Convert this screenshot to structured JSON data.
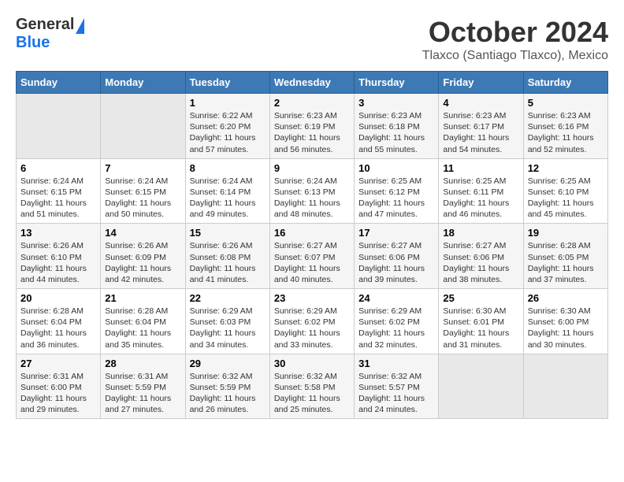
{
  "header": {
    "logo_general": "General",
    "logo_blue": "Blue",
    "month_title": "October 2024",
    "location": "Tlaxco (Santiago Tlaxco), Mexico"
  },
  "days_of_week": [
    "Sunday",
    "Monday",
    "Tuesday",
    "Wednesday",
    "Thursday",
    "Friday",
    "Saturday"
  ],
  "weeks": [
    [
      {
        "day": "",
        "info": ""
      },
      {
        "day": "",
        "info": ""
      },
      {
        "day": "1",
        "sunrise": "6:22 AM",
        "sunset": "6:20 PM",
        "daylight": "11 hours and 57 minutes."
      },
      {
        "day": "2",
        "sunrise": "6:23 AM",
        "sunset": "6:19 PM",
        "daylight": "11 hours and 56 minutes."
      },
      {
        "day": "3",
        "sunrise": "6:23 AM",
        "sunset": "6:18 PM",
        "daylight": "11 hours and 55 minutes."
      },
      {
        "day": "4",
        "sunrise": "6:23 AM",
        "sunset": "6:17 PM",
        "daylight": "11 hours and 54 minutes."
      },
      {
        "day": "5",
        "sunrise": "6:23 AM",
        "sunset": "6:16 PM",
        "daylight": "11 hours and 52 minutes."
      }
    ],
    [
      {
        "day": "6",
        "sunrise": "6:24 AM",
        "sunset": "6:15 PM",
        "daylight": "11 hours and 51 minutes."
      },
      {
        "day": "7",
        "sunrise": "6:24 AM",
        "sunset": "6:15 PM",
        "daylight": "11 hours and 50 minutes."
      },
      {
        "day": "8",
        "sunrise": "6:24 AM",
        "sunset": "6:14 PM",
        "daylight": "11 hours and 49 minutes."
      },
      {
        "day": "9",
        "sunrise": "6:24 AM",
        "sunset": "6:13 PM",
        "daylight": "11 hours and 48 minutes."
      },
      {
        "day": "10",
        "sunrise": "6:25 AM",
        "sunset": "6:12 PM",
        "daylight": "11 hours and 47 minutes."
      },
      {
        "day": "11",
        "sunrise": "6:25 AM",
        "sunset": "6:11 PM",
        "daylight": "11 hours and 46 minutes."
      },
      {
        "day": "12",
        "sunrise": "6:25 AM",
        "sunset": "6:10 PM",
        "daylight": "11 hours and 45 minutes."
      }
    ],
    [
      {
        "day": "13",
        "sunrise": "6:26 AM",
        "sunset": "6:10 PM",
        "daylight": "11 hours and 44 minutes."
      },
      {
        "day": "14",
        "sunrise": "6:26 AM",
        "sunset": "6:09 PM",
        "daylight": "11 hours and 42 minutes."
      },
      {
        "day": "15",
        "sunrise": "6:26 AM",
        "sunset": "6:08 PM",
        "daylight": "11 hours and 41 minutes."
      },
      {
        "day": "16",
        "sunrise": "6:27 AM",
        "sunset": "6:07 PM",
        "daylight": "11 hours and 40 minutes."
      },
      {
        "day": "17",
        "sunrise": "6:27 AM",
        "sunset": "6:06 PM",
        "daylight": "11 hours and 39 minutes."
      },
      {
        "day": "18",
        "sunrise": "6:27 AM",
        "sunset": "6:06 PM",
        "daylight": "11 hours and 38 minutes."
      },
      {
        "day": "19",
        "sunrise": "6:28 AM",
        "sunset": "6:05 PM",
        "daylight": "11 hours and 37 minutes."
      }
    ],
    [
      {
        "day": "20",
        "sunrise": "6:28 AM",
        "sunset": "6:04 PM",
        "daylight": "11 hours and 36 minutes."
      },
      {
        "day": "21",
        "sunrise": "6:28 AM",
        "sunset": "6:04 PM",
        "daylight": "11 hours and 35 minutes."
      },
      {
        "day": "22",
        "sunrise": "6:29 AM",
        "sunset": "6:03 PM",
        "daylight": "11 hours and 34 minutes."
      },
      {
        "day": "23",
        "sunrise": "6:29 AM",
        "sunset": "6:02 PM",
        "daylight": "11 hours and 33 minutes."
      },
      {
        "day": "24",
        "sunrise": "6:29 AM",
        "sunset": "6:02 PM",
        "daylight": "11 hours and 32 minutes."
      },
      {
        "day": "25",
        "sunrise": "6:30 AM",
        "sunset": "6:01 PM",
        "daylight": "11 hours and 31 minutes."
      },
      {
        "day": "26",
        "sunrise": "6:30 AM",
        "sunset": "6:00 PM",
        "daylight": "11 hours and 30 minutes."
      }
    ],
    [
      {
        "day": "27",
        "sunrise": "6:31 AM",
        "sunset": "6:00 PM",
        "daylight": "11 hours and 29 minutes."
      },
      {
        "day": "28",
        "sunrise": "6:31 AM",
        "sunset": "5:59 PM",
        "daylight": "11 hours and 27 minutes."
      },
      {
        "day": "29",
        "sunrise": "6:32 AM",
        "sunset": "5:59 PM",
        "daylight": "11 hours and 26 minutes."
      },
      {
        "day": "30",
        "sunrise": "6:32 AM",
        "sunset": "5:58 PM",
        "daylight": "11 hours and 25 minutes."
      },
      {
        "day": "31",
        "sunrise": "6:32 AM",
        "sunset": "5:57 PM",
        "daylight": "11 hours and 24 minutes."
      },
      {
        "day": "",
        "info": ""
      },
      {
        "day": "",
        "info": ""
      }
    ]
  ],
  "labels": {
    "sunrise": "Sunrise:",
    "sunset": "Sunset:",
    "daylight": "Daylight:"
  }
}
